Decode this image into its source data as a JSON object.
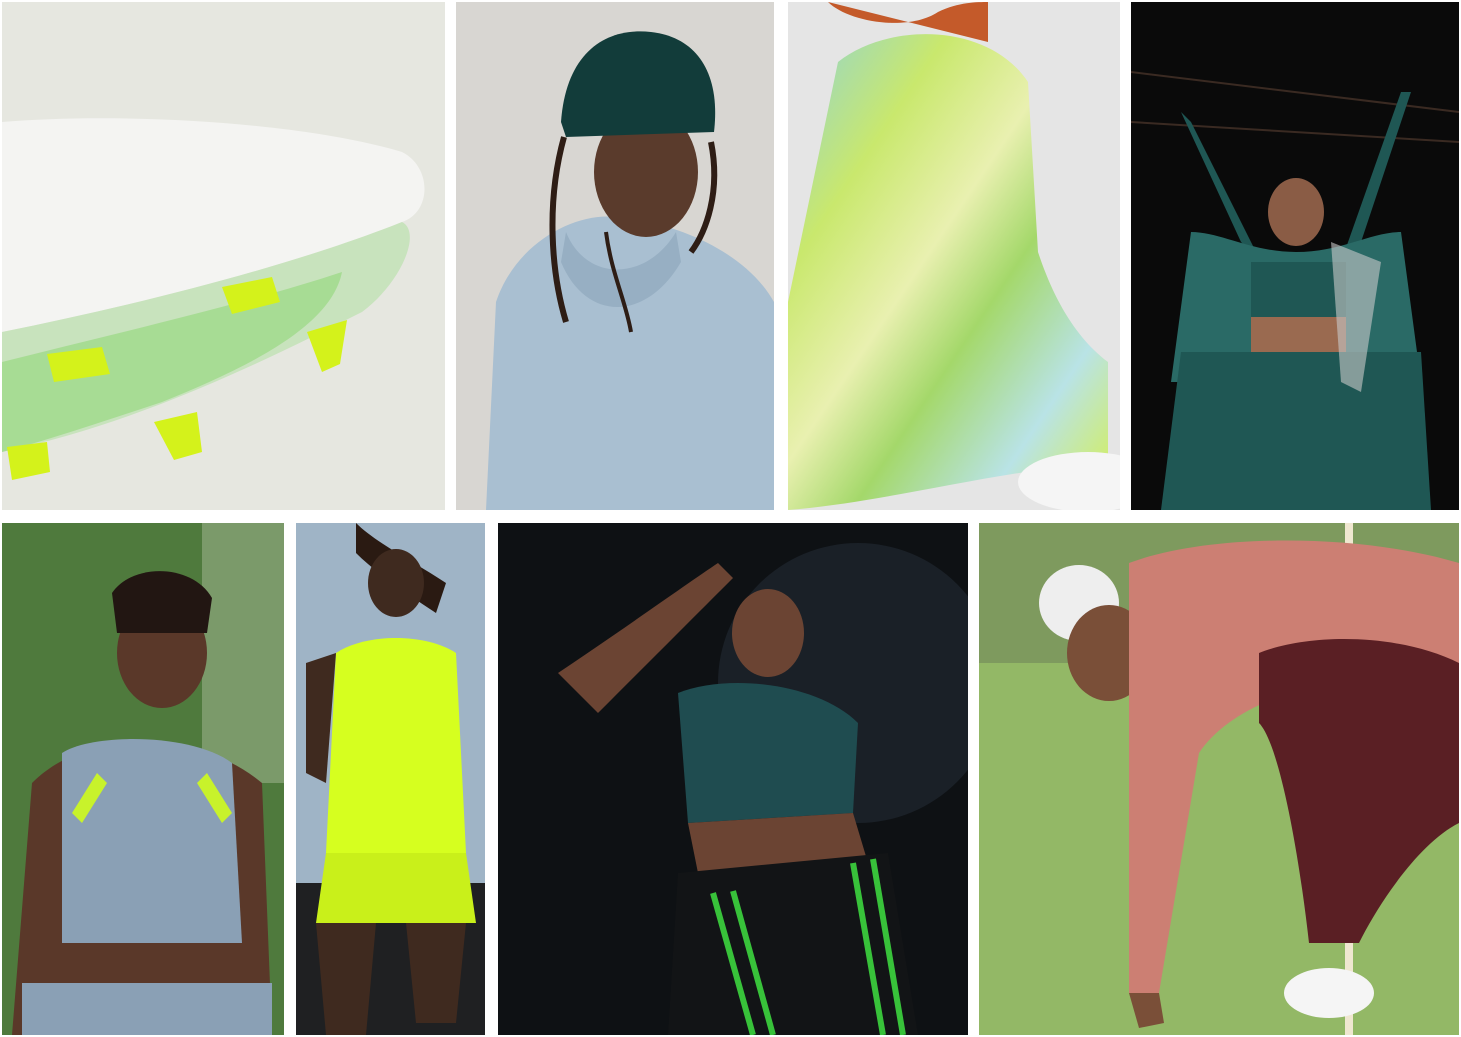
{
  "collage": {
    "tiles": [
      {
        "subject": "football-boot-sole-with-neon-studs",
        "palette": [
          "#e6e7e0",
          "#f4f4f2",
          "#9fd98a",
          "#d4f21b"
        ]
      },
      {
        "subject": "man-in-beanie-and-light-blue-hoodie",
        "palette": [
          "#d8d6d2",
          "#a9bfd1",
          "#123c3a",
          "#4a2f22"
        ]
      },
      {
        "subject": "woman-in-iridescent-striped-bodysuit",
        "palette": [
          "#e5e5e5",
          "#c9e86d",
          "#8fd3d6",
          "#c45a2a"
        ]
      },
      {
        "subject": "woman-in-teal-track-jacket-arms-raised",
        "palette": [
          "#0a0a0a",
          "#1f5754",
          "#2a6a66",
          "#c9c9c9"
        ]
      },
      {
        "subject": "athlete-in-grey-high-neck-crop-top",
        "palette": [
          "#4f7a3d",
          "#8aa0b5",
          "#c8f22b",
          "#4b2f24"
        ]
      },
      {
        "subject": "runner-in-neon-yellow-singlet",
        "palette": [
          "#9fb4c6",
          "#d6ff1f",
          "#3f2a1f",
          "#1f2022"
        ]
      },
      {
        "subject": "dancer-in-teal-crop-top-black-track-pants",
        "palette": [
          "#0e1114",
          "#1f4c50",
          "#121416",
          "#38c23a"
        ]
      },
      {
        "subject": "golfer-in-pink-track-jacket-on-green",
        "palette": [
          "#a5c47a",
          "#cc7f73",
          "#5a1f24",
          "#f5f5f5"
        ]
      }
    ]
  }
}
